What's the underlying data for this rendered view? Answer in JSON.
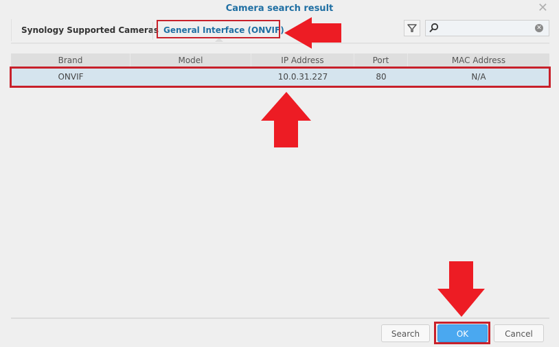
{
  "dialog": {
    "title": "Camera search result",
    "close_icon": "close-icon"
  },
  "tabs": [
    {
      "label": "Synology Supported Cameras",
      "active": false
    },
    {
      "label": "General Interface (ONVIF)",
      "active": true
    }
  ],
  "toolbar": {
    "filter_icon": "filter-icon",
    "search_icon": "search-icon",
    "search_value": "",
    "search_placeholder": "",
    "clear_icon": "clear-icon"
  },
  "table": {
    "columns": [
      "Brand",
      "Model",
      "IP Address",
      "Port",
      "MAC Address"
    ],
    "rows": [
      {
        "brand": "ONVIF",
        "model": "",
        "ip": "10.0.31.227",
        "port": "80",
        "mac": "N/A",
        "selected": true
      }
    ]
  },
  "footer": {
    "search_label": "Search",
    "ok_label": "OK",
    "cancel_label": "Cancel"
  },
  "annotations": {
    "highlight_color": "#c8202a",
    "arrow_color": "#ed1c24",
    "arrows": [
      "arrow-left-to-onvif-tab",
      "arrow-up-to-result-row",
      "arrow-down-to-ok-button"
    ]
  },
  "colors": {
    "accent": "#1f6fa3",
    "ok_button": "#4aa8f0",
    "selected_row": "#d5e4ee"
  }
}
